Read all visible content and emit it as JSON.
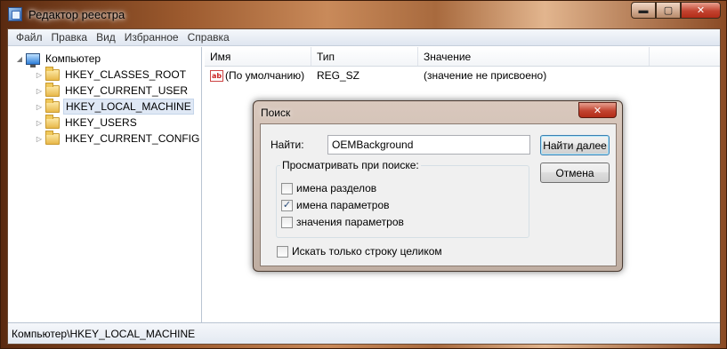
{
  "window": {
    "title": "Редактор реестра",
    "minimize": "▬",
    "maximize": "▢",
    "close": "✕"
  },
  "menu": [
    "Файл",
    "Правка",
    "Вид",
    "Избранное",
    "Справка"
  ],
  "tree": {
    "root": "Компьютер",
    "items": [
      "HKEY_CLASSES_ROOT",
      "HKEY_CURRENT_USER",
      "HKEY_LOCAL_MACHINE",
      "HKEY_USERS",
      "HKEY_CURRENT_CONFIG"
    ],
    "selected": "HKEY_LOCAL_MACHINE"
  },
  "list": {
    "columns": [
      "Имя",
      "Тип",
      "Значение"
    ],
    "rows": [
      {
        "name": "(По умолчанию)",
        "type": "REG_SZ",
        "value": "(значение не присвоено)",
        "icon": "ab"
      }
    ]
  },
  "status": "Компьютер\\HKEY_LOCAL_MACHINE",
  "dialog": {
    "title": "Поиск",
    "close": "✕",
    "find_label": "Найти:",
    "find_value": "OEMBackground",
    "find_next_button": "Найти далее",
    "cancel_button": "Отмена",
    "group_label": "Просматривать при поиске:",
    "options": [
      {
        "label": "имена разделов",
        "checked": false
      },
      {
        "label": "имена параметров",
        "checked": true
      },
      {
        "label": "значения параметров",
        "checked": false
      }
    ],
    "whole_string": {
      "label": "Искать только строку целиком",
      "checked": false
    }
  }
}
